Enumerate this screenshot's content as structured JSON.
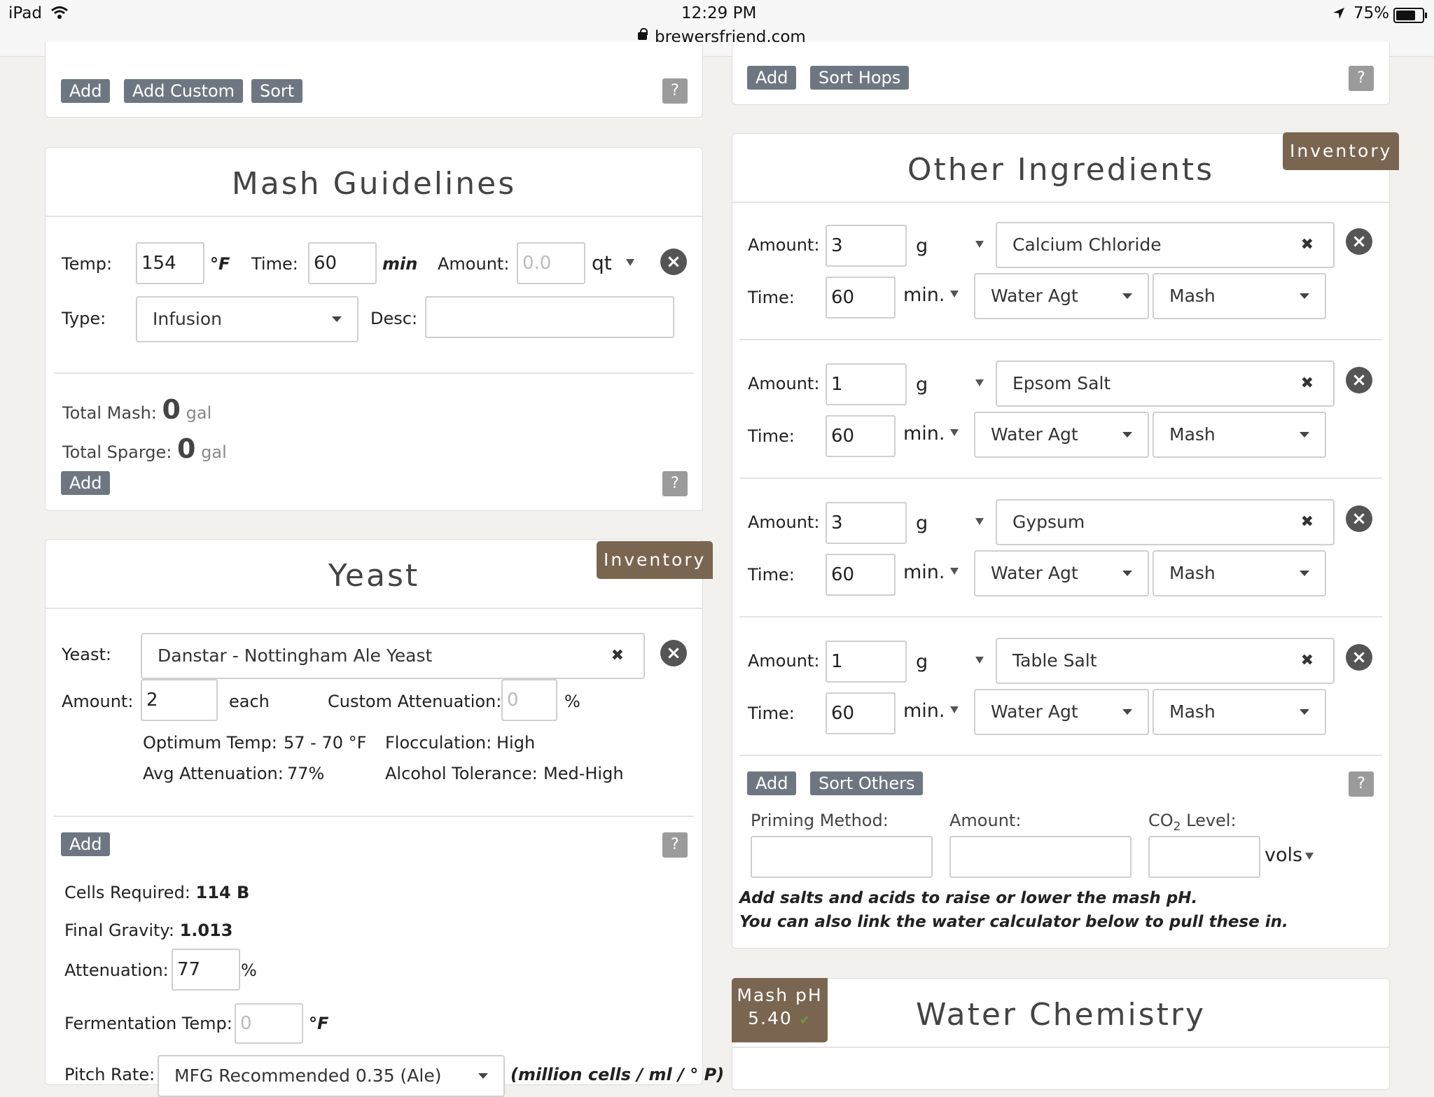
{
  "status_bar": {
    "device": "iPad",
    "time": "12:29 PM",
    "url": "brewersfriend.com",
    "battery": "75%",
    "battery_level": 0.75
  },
  "top_left": {
    "add": "Add",
    "add_custom": "Add Custom",
    "sort": "Sort",
    "help": "?"
  },
  "top_right": {
    "add": "Add",
    "sort_hops": "Sort Hops",
    "help": "?"
  },
  "mash": {
    "title": "Mash Guidelines",
    "temp_label": "Temp:",
    "temp_value": "154",
    "temp_unit": "°F",
    "time_label": "Time:",
    "time_value": "60",
    "time_unit": "min",
    "amount_label": "Amount:",
    "amount_placeholder": "0.0",
    "amount_unit": "qt",
    "type_label": "Type:",
    "type_value": "Infusion",
    "desc_label": "Desc:",
    "total_mash_label": "Total Mash:",
    "total_mash_value": "0",
    "total_mash_unit": "gal",
    "total_sparge_label": "Total Sparge:",
    "total_sparge_value": "0",
    "total_sparge_unit": "gal",
    "add": "Add",
    "help": "?"
  },
  "yeast": {
    "title": "Yeast",
    "inventory": "Inventory",
    "yeast_label": "Yeast:",
    "yeast_value": "Danstar - Nottingham Ale Yeast",
    "amount_label": "Amount:",
    "amount_value": "2",
    "amount_unit": "each",
    "custom_att_label": "Custom Attenuation:",
    "custom_att_placeholder": "0",
    "custom_att_unit": "%",
    "opt_temp_label": "Optimum Temp:",
    "opt_temp_value": "57 - 70 °F",
    "floc_label": "Flocculation:",
    "floc_value": "High",
    "avg_att_label": "Avg Attenuation:",
    "avg_att_value": "77%",
    "alc_tol_label": "Alcohol Tolerance:",
    "alc_tol_value": "Med-High",
    "add": "Add",
    "help": "?",
    "cells_label": "Cells Required:",
    "cells_value": "114 B",
    "fg_label": "Final Gravity:",
    "fg_value": "1.013",
    "attenuation_label": "Attenuation:",
    "attenuation_value": "77",
    "attenuation_unit": "%",
    "ferm_label": "Fermentation Temp:",
    "ferm_placeholder": "0",
    "ferm_unit": "°F",
    "pitch_label": "Pitch Rate:",
    "pitch_value": "MFG Recommended 0.35 (Ale)",
    "pitch_unit": "(million cells / ml / ° P)"
  },
  "other": {
    "title": "Other Ingredients",
    "inventory": "Inventory",
    "amount_label": "Amount:",
    "time_label": "Time:",
    "unit": "g",
    "time_unit": "min.",
    "items": [
      {
        "amount": "3",
        "name": "Calcium Chloride",
        "time": "60",
        "type": "Water Agt",
        "use": "Mash"
      },
      {
        "amount": "1",
        "name": "Epsom Salt",
        "time": "60",
        "type": "Water Agt",
        "use": "Mash"
      },
      {
        "amount": "3",
        "name": "Gypsum",
        "time": "60",
        "type": "Water Agt",
        "use": "Mash"
      },
      {
        "amount": "1",
        "name": "Table Salt",
        "time": "60",
        "type": "Water Agt",
        "use": "Mash"
      }
    ],
    "add": "Add",
    "sort_others": "Sort Others",
    "help": "?",
    "priming_label": "Priming Method:",
    "priming_amount_label": "Amount:",
    "co2_label_a": "CO",
    "co2_label_sub": "2",
    "co2_label_b": " Level:",
    "co2_unit": "vols",
    "note1": "Add salts and acids to raise or lower the mash pH.",
    "note2": "You can also link the water calculator below to pull these in."
  },
  "water": {
    "title": "Water Chemistry",
    "mash_ph_label": "Mash pH",
    "mash_ph_value": "5.40"
  }
}
